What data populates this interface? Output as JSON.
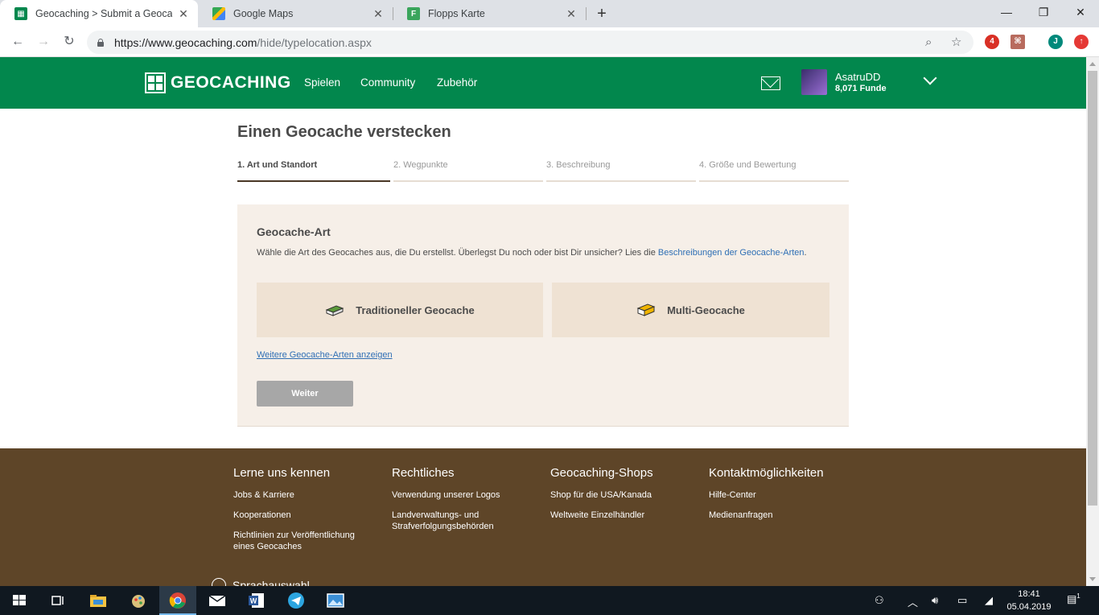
{
  "browser": {
    "tabs": [
      {
        "title": "Geocaching > Submit a Geocache",
        "active": true
      },
      {
        "title": "Google Maps",
        "active": false
      },
      {
        "title": "Flopps Karte",
        "active": false
      }
    ],
    "new_tab": "+",
    "url_host": "https://www.geocaching.com",
    "url_path": "/hide/typelocation.aspx",
    "extension_badge": "4",
    "profile_initial": "J"
  },
  "header": {
    "logo_text": "GEOCACHING",
    "nav": [
      "Spielen",
      "Community",
      "Zubehör"
    ],
    "username": "AsatruDD",
    "finds": "8,071 Funde"
  },
  "main": {
    "title": "Einen Geocache verstecken",
    "steps": [
      {
        "label": "1. Art und Standort",
        "active": true
      },
      {
        "label": "2. Wegpunkte",
        "active": false
      },
      {
        "label": "3. Beschreibung",
        "active": false
      },
      {
        "label": "4. Größe und Bewertung",
        "active": false
      }
    ],
    "panel": {
      "heading": "Geocache-Art",
      "description": "Wähle die Art des Geocaches aus, die Du erstellst. Überlegst Du noch oder bist Dir unsicher? Lies die ",
      "description_link": "Beschreibungen der Geocache-Arten",
      "description_end": ".",
      "types": [
        "Traditioneller Geocache",
        "Multi-Geocache"
      ],
      "more_link": "Weitere Geocache-Arten anzeigen",
      "continue_button": "Weiter"
    }
  },
  "footer": {
    "columns": [
      {
        "heading": "Lerne uns kennen",
        "links": [
          "Jobs & Karriere",
          "Kooperationen",
          "Richtlinien zur Veröffentlichung eines Geocaches"
        ]
      },
      {
        "heading": "Rechtliches",
        "links": [
          "Verwendung unserer Logos",
          "Landverwaltungs- und Strafverfolgungsbehörden"
        ]
      },
      {
        "heading": "Geocaching-Shops",
        "links": [
          "Shop für die USA/Kanada",
          "Weltweite Einzelhändler"
        ]
      },
      {
        "heading": "Kontaktmöglichkeiten",
        "links": [
          "Hilfe-Center",
          "Medienanfragen"
        ]
      }
    ],
    "language": "Sprachauswahl"
  },
  "taskbar": {
    "time": "18:41",
    "date": "05.04.2019",
    "notifications": "1"
  },
  "colors": {
    "brand_green": "#02874d",
    "footer_brown": "#5e4528",
    "panel_bg": "#f6efe8",
    "card_bg": "#efe2d3",
    "link": "#2f6fb5"
  }
}
